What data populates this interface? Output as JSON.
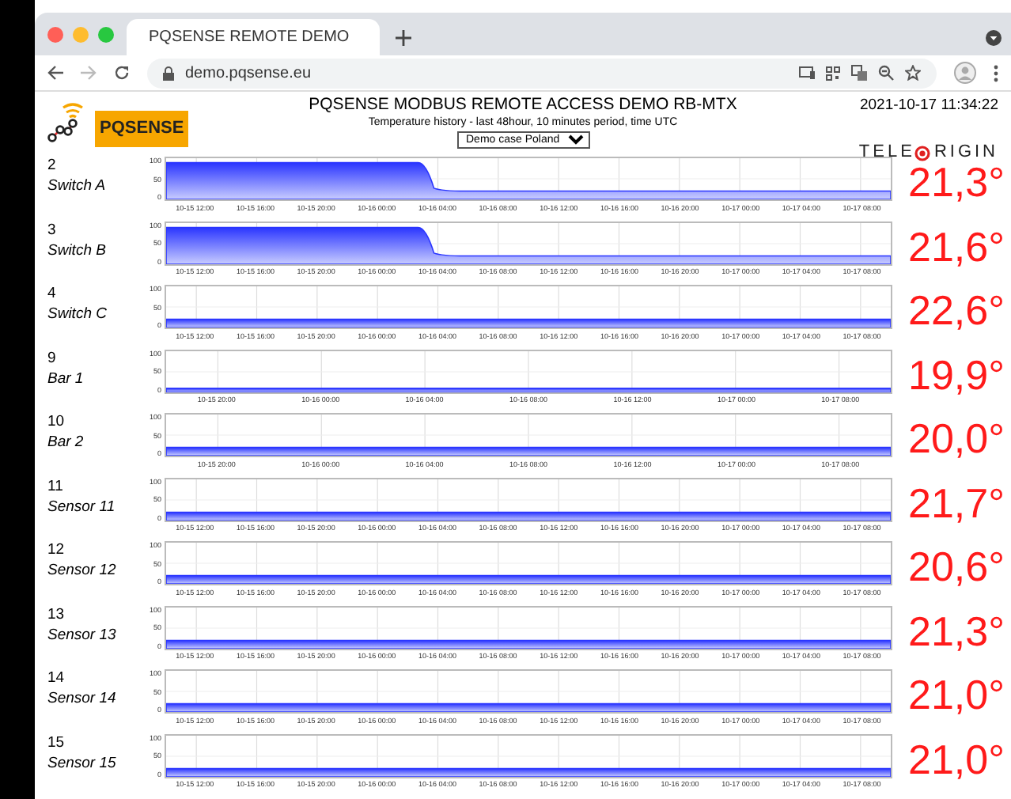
{
  "browser": {
    "tab_title": "PQSENSE REMOTE DEMO",
    "url": "demo.pqsense.eu"
  },
  "header": {
    "logo_text": "PQSENSE",
    "title": "PQSENSE MODBUS REMOTE ACCESS DEMO RB-MTX",
    "subtitle": "Temperature history - last 48hour, 10 minutes period, time UTC",
    "dropdown": "Demo case Poland",
    "datetime": "2021-10-17 11:34:22",
    "brand_left": "TELE",
    "brand_right": "RIGIN"
  },
  "rows": [
    {
      "number": "2",
      "name": "Switch A",
      "kind": "step-down",
      "yticks": [
        "100",
        "50",
        "0"
      ],
      "xticks": [
        "10-15 12:00",
        "10-15 16:00",
        "10-15 20:00",
        "10-16 00:00",
        "10-16 04:00",
        "10-16 08:00",
        "10-16 12:00",
        "10-16 16:00",
        "10-16 20:00",
        "10-17 00:00",
        "10-17 04:00",
        "10-17 08:00"
      ],
      "temperature": "21,3°"
    },
    {
      "number": "3",
      "name": "Switch B",
      "kind": "step-down",
      "yticks": [
        "100",
        "50",
        "0"
      ],
      "xticks": [
        "10-15 12:00",
        "10-15 16:00",
        "10-15 20:00",
        "10-16 00:00",
        "10-16 04:00",
        "10-16 08:00",
        "10-16 12:00",
        "10-16 16:00",
        "10-16 20:00",
        "10-17 00:00",
        "10-17 04:00",
        "10-17 08:00"
      ],
      "temperature": "21,6°"
    },
    {
      "number": "4",
      "name": "Switch C",
      "kind": "flat",
      "yticks": [
        "100",
        "50",
        "0"
      ],
      "xticks": [
        "10-15 12:00",
        "10-15 16:00",
        "10-15 20:00",
        "10-16 00:00",
        "10-16 04:00",
        "10-16 08:00",
        "10-16 12:00",
        "10-16 16:00",
        "10-16 20:00",
        "10-17 00:00",
        "10-17 04:00",
        "10-17 08:00"
      ],
      "temperature": "22,6°"
    },
    {
      "number": "9",
      "name": "Bar 1",
      "kind": "low",
      "yticks": [
        "100",
        "50",
        "0"
      ],
      "xticks": [
        "10-15 20:00",
        "10-16 00:00",
        "10-16 04:00",
        "10-16 08:00",
        "10-16 12:00",
        "10-17 00:00",
        "10-17 08:00"
      ],
      "temperature": "19,9°"
    },
    {
      "number": "10",
      "name": "Bar 2",
      "kind": "flat",
      "yticks": [
        "100",
        "50",
        "0"
      ],
      "xticks": [
        "10-15 20:00",
        "10-16 00:00",
        "10-16 04:00",
        "10-16 08:00",
        "10-16 12:00",
        "10-17 00:00",
        "10-17 08:00"
      ],
      "temperature": "20,0°"
    },
    {
      "number": "11",
      "name": "Sensor 11",
      "kind": "flat",
      "yticks": [
        "100",
        "50",
        "0"
      ],
      "xticks": [
        "10-15 12:00",
        "10-15 16:00",
        "10-15 20:00",
        "10-16 00:00",
        "10-16 04:00",
        "10-16 08:00",
        "10-16 12:00",
        "10-16 16:00",
        "10-16 20:00",
        "10-17 00:00",
        "10-17 04:00",
        "10-17 08:00"
      ],
      "temperature": "21,7°"
    },
    {
      "number": "12",
      "name": "Sensor 12",
      "kind": "flat",
      "yticks": [
        "100",
        "50",
        "0"
      ],
      "xticks": [
        "10-15 12:00",
        "10-15 16:00",
        "10-15 20:00",
        "10-16 00:00",
        "10-16 04:00",
        "10-16 08:00",
        "10-16 12:00",
        "10-16 16:00",
        "10-16 20:00",
        "10-17 00:00",
        "10-17 04:00",
        "10-17 08:00"
      ],
      "temperature": "20,6°"
    },
    {
      "number": "13",
      "name": "Sensor 13",
      "kind": "flat",
      "yticks": [
        "100",
        "50",
        "0"
      ],
      "xticks": [
        "10-15 12:00",
        "10-15 16:00",
        "10-15 20:00",
        "10-16 00:00",
        "10-16 04:00",
        "10-16 08:00",
        "10-16 12:00",
        "10-16 16:00",
        "10-16 20:00",
        "10-17 00:00",
        "10-17 04:00",
        "10-17 08:00"
      ],
      "temperature": "21,3°"
    },
    {
      "number": "14",
      "name": "Sensor 14",
      "kind": "flat",
      "yticks": [
        "100",
        "50",
        "0"
      ],
      "xticks": [
        "10-15 12:00",
        "10-15 16:00",
        "10-15 20:00",
        "10-16 00:00",
        "10-16 04:00",
        "10-16 08:00",
        "10-16 12:00",
        "10-16 16:00",
        "10-16 20:00",
        "10-17 00:00",
        "10-17 04:00",
        "10-17 08:00"
      ],
      "temperature": "21,0°"
    },
    {
      "number": "15",
      "name": "Sensor 15",
      "kind": "flat",
      "yticks": [
        "100",
        "50",
        "0"
      ],
      "xticks": [
        "10-15 12:00",
        "10-15 16:00",
        "10-15 20:00",
        "10-16 00:00",
        "10-16 04:00",
        "10-16 08:00",
        "10-16 12:00",
        "10-16 16:00",
        "10-16 20:00",
        "10-17 00:00",
        "10-17 04:00",
        "10-17 08:00"
      ],
      "temperature": "21,0°"
    }
  ]
}
